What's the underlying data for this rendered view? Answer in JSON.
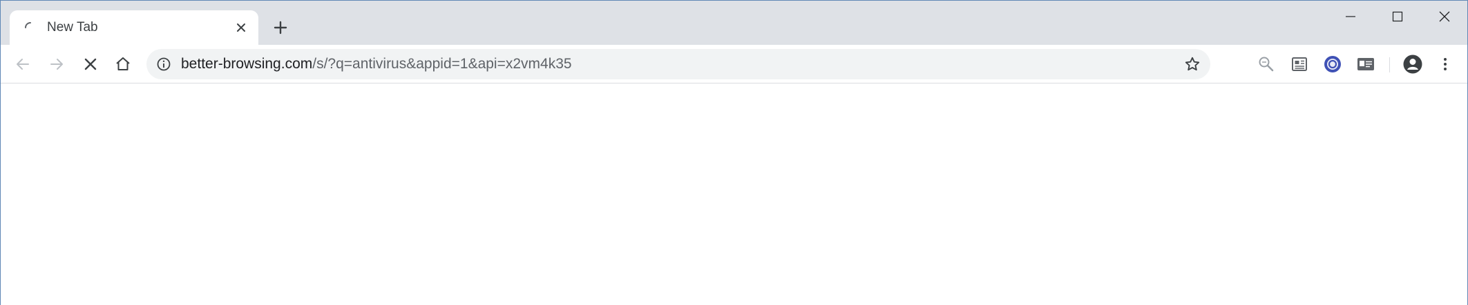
{
  "tab": {
    "title": "New Tab"
  },
  "address_bar": {
    "host": "better-browsing.com",
    "path": "/s/?q=antivirus&appid=1&api=x2vm4k35"
  },
  "colors": {
    "tabstrip": "#dee1e6",
    "omnibox": "#f1f3f4",
    "icon": "#5f6368",
    "extension_accent": "#3f51b5"
  },
  "icons": [
    "loading-spinner-icon",
    "close-icon",
    "plus-icon",
    "minimize-icon",
    "maximize-icon",
    "back-icon",
    "forward-icon",
    "stop-icon",
    "home-icon",
    "info-icon",
    "star-icon",
    "search-extension-icon",
    "newspaper-extension-icon",
    "circle-extension-icon",
    "id-card-extension-icon",
    "profile-icon",
    "kebab-menu-icon"
  ]
}
